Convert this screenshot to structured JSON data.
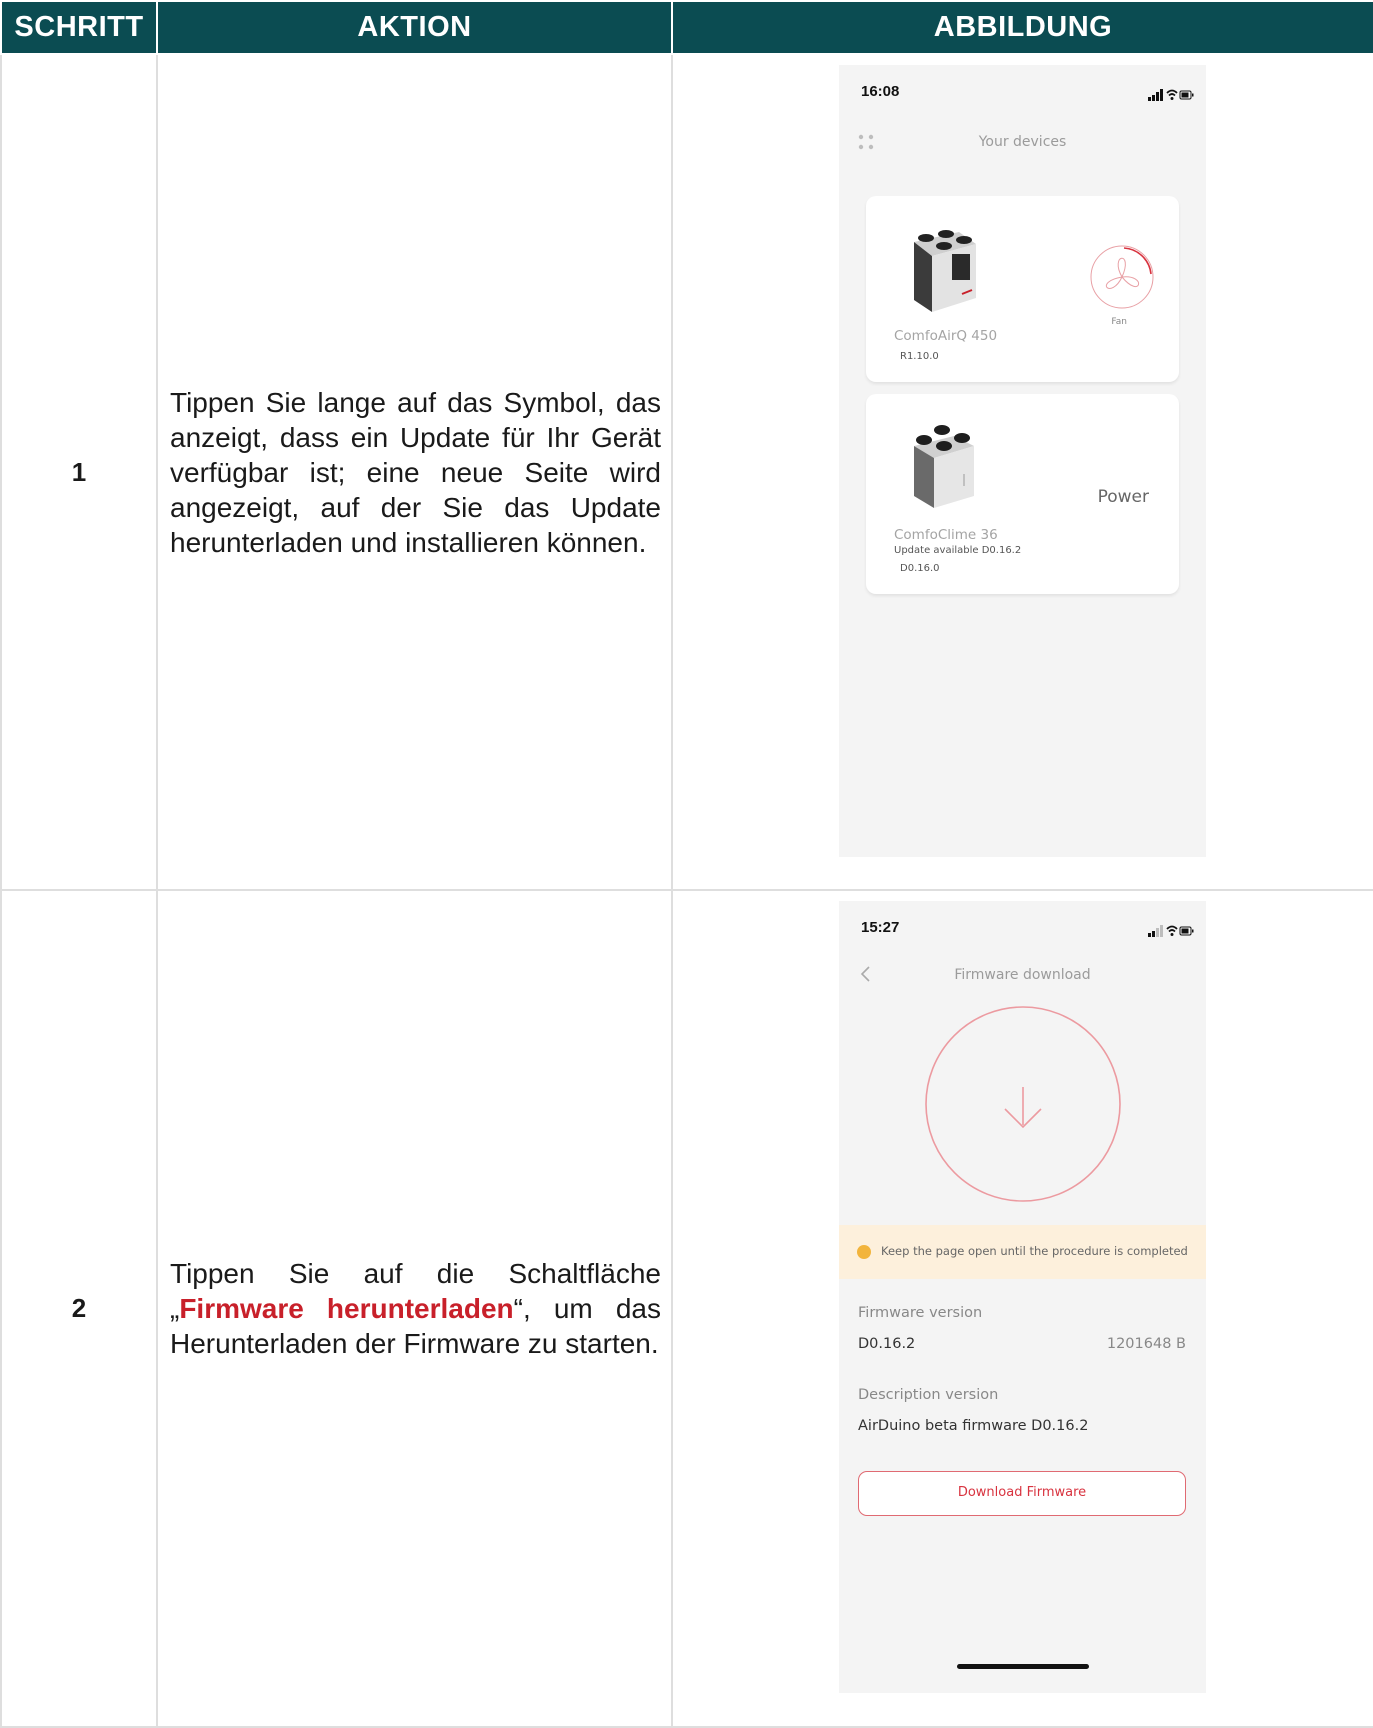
{
  "header": {
    "col_step": "SCHRITT",
    "col_action": "AKTION",
    "col_figure": "ABBILDUNG"
  },
  "rows": [
    {
      "number": "1",
      "action": "Tippen Sie lange auf das Symbol, das anzeigt, dass ein Update für Ihr Gerät verfügbar ist; eine neue Seite wird angezeigt, auf der Sie das Update herunterladen und installieren können.",
      "phone": {
        "time": "16:08",
        "title": "Your devices",
        "devices": [
          {
            "name": "ComfoAirQ 450",
            "version": "R1.10.0",
            "status": "Fan"
          },
          {
            "name": "ComfoClime 36",
            "update": "Update available D0.16.2",
            "version": "D0.16.0",
            "status": "Power"
          }
        ]
      }
    },
    {
      "number": "2",
      "action_before": "Tippen Sie auf die Schaltfläche „",
      "action_highlight": "Firmware herunterladen",
      "action_after": "“, um das Herunterladen der Firmware zu starten.",
      "phone": {
        "time": "15:27",
        "title": "Firmware download",
        "notice": "Keep the page open until the procedure is completed",
        "firmware_label": "Firmware version",
        "firmware_value": "D0.16.2",
        "firmware_size": "1201648 B",
        "description_label": "Description version",
        "description_value": "AirDuino beta firmware D0.16.2",
        "button": "Download Firmware"
      }
    }
  ],
  "colors": {
    "header_bg": "#0b4c52",
    "highlight": "#c8202a",
    "accent_pink": "#e06a72"
  }
}
